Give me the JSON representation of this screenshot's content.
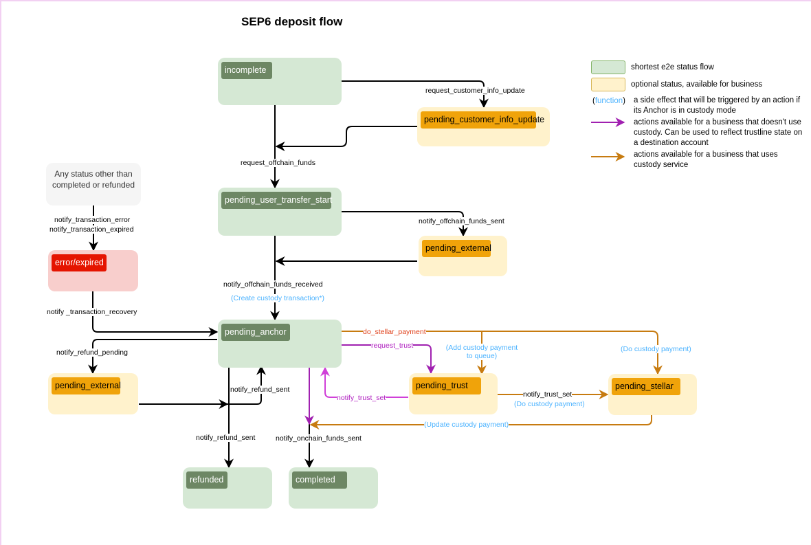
{
  "title": "SEP6 deposit flow",
  "colors": {
    "green_bg": "#d5e8d4",
    "green_tag": "#6d8764",
    "yellow_bg": "#fff2cc",
    "orange_tag": "#f0a30a",
    "red_bg": "#f8cecc",
    "red_tag": "#e51400",
    "purple_arrow": "#a020b0",
    "orange_arrow": "#c77b10",
    "function_blue": "#4cb3ff"
  },
  "states": {
    "incomplete": "incomplete",
    "pending_customer_info_update": "pending_customer_info_update",
    "pending_user_transfer_start": "pending_user_transfer_start",
    "pending_external_top": "pending_external",
    "pending_anchor": "pending_anchor",
    "pending_external_refund": "pending_external",
    "error_expired": "error/expired",
    "any_status": "Any status other than completed or refunded",
    "pending_trust": "pending_trust",
    "pending_stellar": "pending_stellar",
    "refunded": "refunded",
    "completed": "completed"
  },
  "transitions": {
    "request_customer_info_update": "request_customer_info_update",
    "request_offchain_funds": "request_offchain_funds",
    "notify_offchain_funds_sent": "notify_offchain_funds_sent",
    "notify_offchain_funds_received": "notify_offchain_funds_received",
    "create_custody_transaction": "(Create custody transaction*)",
    "notify_transaction_error": "notify_transaction_error",
    "notify_transaction_expired": "notify_transaction_expired",
    "notify_transaction_recovery": "notify _transaction_recovery",
    "notify_refund_pending": "notify_refund_pending",
    "notify_refund_sent_up": "notify_refund_sent",
    "notify_refund_sent_down": "notify_refund_sent",
    "notify_onchain_funds_sent": "notify_onchain_funds_sent",
    "do_stellar_payment": "do_stellar_payment",
    "request_trust": "request_trust",
    "notify_trust_set_back": "notify_trust_set",
    "notify_trust_set_forward": "notify_trust_set",
    "add_custody_payment": "(Add custody payment to queue)",
    "do_custody_payment_top": "(Do custody payment)",
    "do_custody_payment_mid": "(Do custody payment)",
    "update_custody_payment": "(Update custody payment)"
  },
  "legend": {
    "green": "shortest e2e status flow",
    "yellow": "optional status, available for business",
    "function_word": "function",
    "function_desc": "a side effect that will be triggered by an action if its Anchor is in custody mode",
    "purple": "actions available for a business that doesn't use custody. Can be used to reflect trustline state on a destination account",
    "orange": "actions available for a business that uses custody service"
  }
}
